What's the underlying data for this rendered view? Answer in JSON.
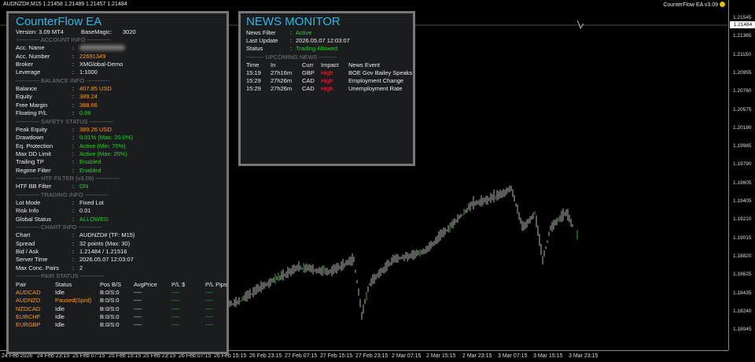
{
  "window": {
    "symbol_line": "AUDNZD#,M15  1.21458 1.21489 1.21457 1.21484",
    "brand": "CounterFlow EA  v3.09"
  },
  "price_axis": {
    "current": "1.21484",
    "labels": [
      "1.21545",
      "1.21365",
      "1.21150",
      "1.20955",
      "1.20760",
      "1.20575",
      "1.20180",
      "1.19985",
      "1.19790",
      "1.19605",
      "1.19405",
      "1.19210",
      "1.19015",
      "1.18820",
      "1.18625",
      "1.18435",
      "1.18240",
      "1.18045"
    ]
  },
  "time_axis": {
    "labels": [
      "24 Feb 2026",
      "24 Feb 23:15",
      "25 Feb 07:15",
      "25 Feb 15:15",
      "25 Feb 23:15",
      "26 Feb 07:15",
      "26 Feb 15:15",
      "26 Feb 23:15",
      "27 Feb 07:15",
      "27 Feb 15:15",
      "27 Feb 23:15",
      "2 Mar 07:15",
      "2 Mar 15:15",
      "2 Mar 23:15",
      "3 Mar 07:15",
      "3 Mar 15:15",
      "3 Mar 23:15"
    ]
  },
  "ea_panel": {
    "title": "CounterFlow EA",
    "version_label": "Version: 3.09 MT4",
    "basemagic_label": "BaseMagic:",
    "basemagic_value": "3020",
    "sections": {
      "account": "------------ ACCOUNT INFO ------------",
      "balance": "------------ BALANCE INFO ------------",
      "safety": "------------ SAFETY STATUS ------------",
      "htf": "------------ HTF FILTER (v3.09) ------------",
      "trading": "------------ TRADING INFO ------------",
      "chart": "------------ CHART INFO ------------",
      "pair": "------------ PAIR STATUS ------------"
    },
    "account": [
      {
        "label": "Acc. Name",
        "value": "",
        "color": "white",
        "blur": true
      },
      {
        "label": "Acc. Number",
        "value": "22691349",
        "color": "orange"
      },
      {
        "label": "Broker",
        "value": "XMGlobal-Demo",
        "color": "white"
      },
      {
        "label": "Leverage",
        "value": "1:1000",
        "color": "white"
      }
    ],
    "balance": [
      {
        "label": "Balance",
        "value": "407.85 USD",
        "color": "orange"
      },
      {
        "label": "Equity",
        "value": "389.24",
        "color": "orange"
      },
      {
        "label": "Free Margin",
        "value": "388.66",
        "color": "orange"
      },
      {
        "label": "Floating P/L",
        "value": "0.08",
        "color": "green"
      }
    ],
    "safety": [
      {
        "label": "Peak Equity",
        "value": "389.26 USD",
        "color": "orange"
      },
      {
        "label": "Drawdown",
        "value": "0.01% (Max: 20.0%)",
        "color": "green"
      },
      {
        "label": "Eq. Protection",
        "value": "Active (Min: 70%)",
        "color": "green"
      },
      {
        "label": "Max DD Limit",
        "value": "Active (Max: 20%)",
        "color": "green"
      },
      {
        "label": "Trailing TP",
        "value": "Enabled",
        "color": "green"
      },
      {
        "label": "Regime Filter",
        "value": "Enabled",
        "color": "green"
      }
    ],
    "htf": [
      {
        "label": "HTF BB Filter",
        "value": "ON",
        "color": "green"
      }
    ],
    "trading": [
      {
        "label": "Lot Mode",
        "value": "Fixed Lot",
        "color": "white"
      },
      {
        "label": "Risk Info",
        "value": "0.01",
        "color": "white"
      },
      {
        "label": "Global Status",
        "value": "ALLOWED",
        "color": "green"
      }
    ],
    "chart": [
      {
        "label": "Chart",
        "value": "AUDNZD# (TF: M15)",
        "color": "white"
      },
      {
        "label": "Spread",
        "value": "32 points (Max: 30)",
        "color": "white"
      },
      {
        "label": "Bid / Ask",
        "value": "1.21484 / 1.21516",
        "color": "white"
      },
      {
        "label": "Server Time",
        "value": "2026.05.07 12:03:07",
        "color": "white"
      },
      {
        "label": "Max Conc. Pairs",
        "value": "2",
        "color": "white"
      }
    ],
    "pair_headers": [
      "Pair",
      "Status",
      "Pos B/S",
      "AvgPrice",
      "P/L $",
      "P/L Pips"
    ],
    "pairs": [
      {
        "pair": "AUDCAD",
        "status": "Idle",
        "pos": "B:0/S:0",
        "avg": "----",
        "pl": "----",
        "pips": "----",
        "status_color": "white"
      },
      {
        "pair": "AUDNZD",
        "status": "Paused(Sprd)",
        "pos": "B:0/S:0",
        "avg": "----",
        "pl": "----",
        "pips": "----",
        "status_color": "orange"
      },
      {
        "pair": "NZDCAD",
        "status": "Idle",
        "pos": "B:0/S:0",
        "avg": "----",
        "pl": "----",
        "pips": "----",
        "status_color": "white"
      },
      {
        "pair": "EURCHF",
        "status": "Idle",
        "pos": "B:0/S:0",
        "avg": "----",
        "pl": "----",
        "pips": "----",
        "status_color": "white"
      },
      {
        "pair": "EURGBP",
        "status": "Idle",
        "pos": "B:0/S:0",
        "avg": "----",
        "pl": "----",
        "pips": "----",
        "status_color": "white"
      }
    ]
  },
  "news_panel": {
    "title": "NEWS MONITOR",
    "info": [
      {
        "label": "News Filter",
        "value": "Active",
        "color": "green"
      },
      {
        "label": "Last Update",
        "value": "2026.05.07 12:03:07",
        "color": "white"
      },
      {
        "label": "Status",
        "value": "Trading Allowed",
        "color": "green"
      }
    ],
    "upcoming_label": "--------- UPCOMING NEWS ---------",
    "headers": [
      "Time",
      "In",
      "Curr",
      "Impact",
      "News Event"
    ],
    "events": [
      {
        "time": "15:19",
        "in": "27h16m",
        "curr": "GBP",
        "impact": "High",
        "event": "BOE Gov Bailey Speaks"
      },
      {
        "time": "15:29",
        "in": "27h26m",
        "curr": "CAD",
        "impact": "High",
        "event": "Employment Change"
      },
      {
        "time": "15:29",
        "in": "27h26m",
        "curr": "CAD",
        "impact": "High",
        "event": "Unemployment Rate"
      }
    ]
  },
  "colors": {
    "orange": "#ff9c1a",
    "green": "#22d51e",
    "red": "#ff2b2b",
    "title": "#2fb7ea"
  }
}
